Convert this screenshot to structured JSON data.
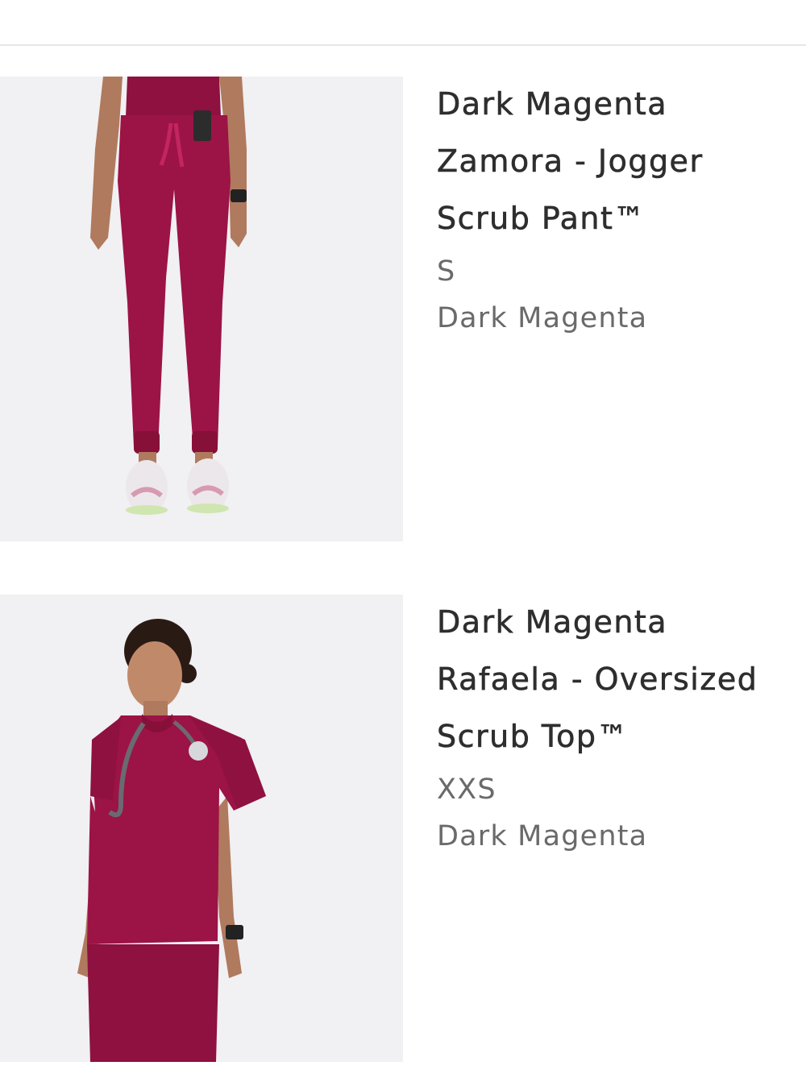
{
  "cart_items": [
    {
      "title": "Dark Magenta Zamora - Jogger Scrub Pant™",
      "size": "S",
      "color": "Dark Magenta",
      "image_icon": "jogger-pants-photo"
    },
    {
      "title": "Dark Magenta Rafaela - Oversized Scrub Top™",
      "size": "XXS",
      "color": "Dark Magenta",
      "image_icon": "scrub-top-photo"
    }
  ],
  "colors": {
    "garment": "#9c1346",
    "background": "#f1f0f3",
    "title_text": "#2e2e2e",
    "meta_text": "#6a6a6a"
  }
}
